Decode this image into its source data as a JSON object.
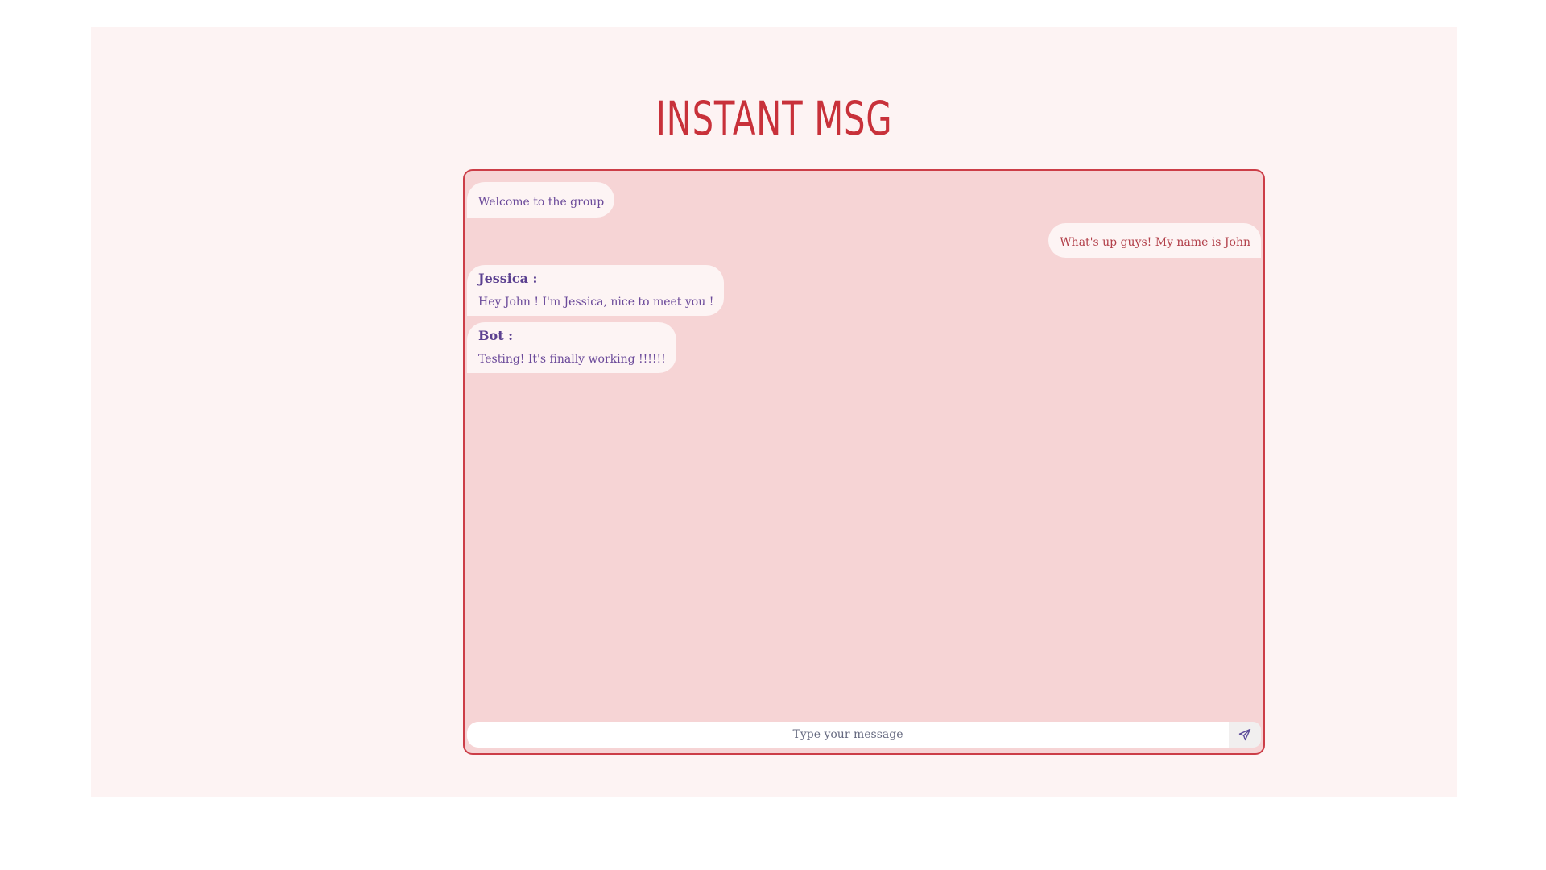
{
  "app": {
    "title": "INSTANT MSG"
  },
  "chat": {
    "messages": [
      {
        "sender": "",
        "text": "Welcome to the group",
        "side": "left"
      },
      {
        "sender": "",
        "text": "What's up guys! My name is John",
        "side": "right"
      },
      {
        "sender": "Jessica :",
        "text": "Hey John ! I'm Jessica, nice to meet you !",
        "side": "left"
      },
      {
        "sender": "Bot :",
        "text": "Testing! It's finally working !!!!!!",
        "side": "left"
      }
    ]
  },
  "composer": {
    "placeholder": "Type your message",
    "value": "",
    "send_icon": "send-icon"
  },
  "colors": {
    "accent": "#c8313a",
    "page_background": "#fdf3f3",
    "chat_background": "#f6d4d5",
    "bubble_background": "#fdf4f4",
    "left_text": "#6b4a9a",
    "right_text": "#b2404a"
  }
}
